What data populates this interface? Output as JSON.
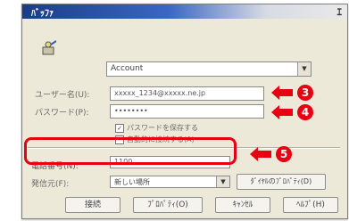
{
  "window": {
    "title": "ﾊﾞｯﾌｧ",
    "close_glyph": "ｴ"
  },
  "account_combo": {
    "value": "Account"
  },
  "username": {
    "label": "ユーザー名(U):",
    "value": "xxxxx_1234@xxxxx.ne.jp",
    "callout": "3"
  },
  "password": {
    "label": "パスワード(P):",
    "value": "••••••••",
    "callout": "4"
  },
  "checkboxes": [
    {
      "label": "パスワードを保存する",
      "checked": true
    },
    {
      "label": "自動的に接続する(A)",
      "checked": false
    }
  ],
  "phone": {
    "label": "電話番号(N):",
    "value": "1100",
    "callout": "5"
  },
  "dial_from": {
    "label": "発信元(F):",
    "value": "新しい場所",
    "button": "ﾀﾞｲﾔﾙのﾌﾟﾛﾊﾟﾃｨ(D)"
  },
  "buttons": {
    "dial": "接続",
    "properties": "ﾌﾟﾛﾊﾟﾃｨ(O)",
    "cancel": "ｷｬﾝｾﾙ",
    "help": "ﾍﾙﾌﾟ(H)"
  },
  "colors": {
    "accent_red": "#e60012",
    "titlebar_blue": "#1b3d87"
  }
}
